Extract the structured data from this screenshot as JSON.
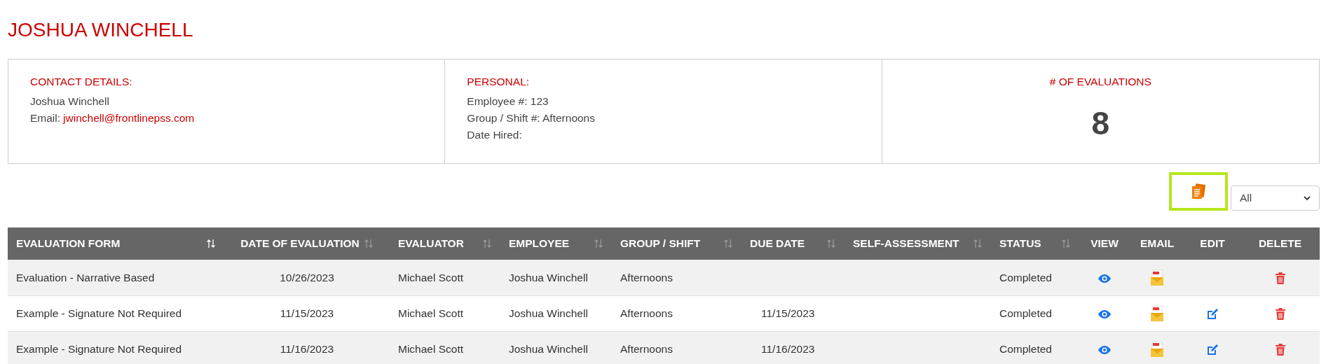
{
  "title": "JOSHUA WINCHELL",
  "contact": {
    "heading": "CONTACT DETAILS:",
    "name": "Joshua Winchell",
    "email_label": "Email:",
    "email": "jwinchell@frontlinepss.com"
  },
  "personal": {
    "heading": "PERSONAL:",
    "lines": [
      "Employee #: 123",
      "Group / Shift #: Afternoons",
      "Date Hired:"
    ]
  },
  "evaluations": {
    "heading": "# OF EVALUATIONS",
    "count": "8"
  },
  "filter": {
    "value": "All"
  },
  "table": {
    "columns": [
      {
        "label": "EVALUATION FORM",
        "sortable": true,
        "sorted": true
      },
      {
        "label": "DATE OF EVALUATION",
        "sortable": true,
        "sorted": false
      },
      {
        "label": "EVALUATOR",
        "sortable": true,
        "sorted": false
      },
      {
        "label": "EMPLOYEE",
        "sortable": true,
        "sorted": false
      },
      {
        "label": "GROUP / SHIFT",
        "sortable": true,
        "sorted": false
      },
      {
        "label": "DUE DATE",
        "sortable": true,
        "sorted": false
      },
      {
        "label": "SELF-ASSESSMENT",
        "sortable": true,
        "sorted": false
      },
      {
        "label": "STATUS",
        "sortable": true,
        "sorted": false
      },
      {
        "label": "VIEW",
        "sortable": false
      },
      {
        "label": "EMAIL",
        "sortable": false
      },
      {
        "label": "EDIT",
        "sortable": false
      },
      {
        "label": "DELETE",
        "sortable": false
      }
    ],
    "rows": [
      {
        "form": "Evaluation - Narrative Based",
        "date": "10/26/2023",
        "evaluator": "Michael Scott",
        "employee": "Joshua Winchell",
        "group": "Afternoons",
        "status": "Completed",
        "editable": false
      },
      {
        "form": "Example - Signature Not Required",
        "date": "11/15/2023",
        "evaluator": "Michael Scott",
        "employee": "Joshua Winchell",
        "group": "Afternoons",
        "due": "11/15/2023",
        "status": "Completed",
        "editable": true
      },
      {
        "form": "Example - Signature Not Required",
        "date": "11/16/2023",
        "evaluator": "Michael Scott",
        "employee": "Joshua Winchell",
        "group": "Afternoons",
        "due": "11/16/2023",
        "status": "Completed",
        "editable": true
      }
    ]
  }
}
